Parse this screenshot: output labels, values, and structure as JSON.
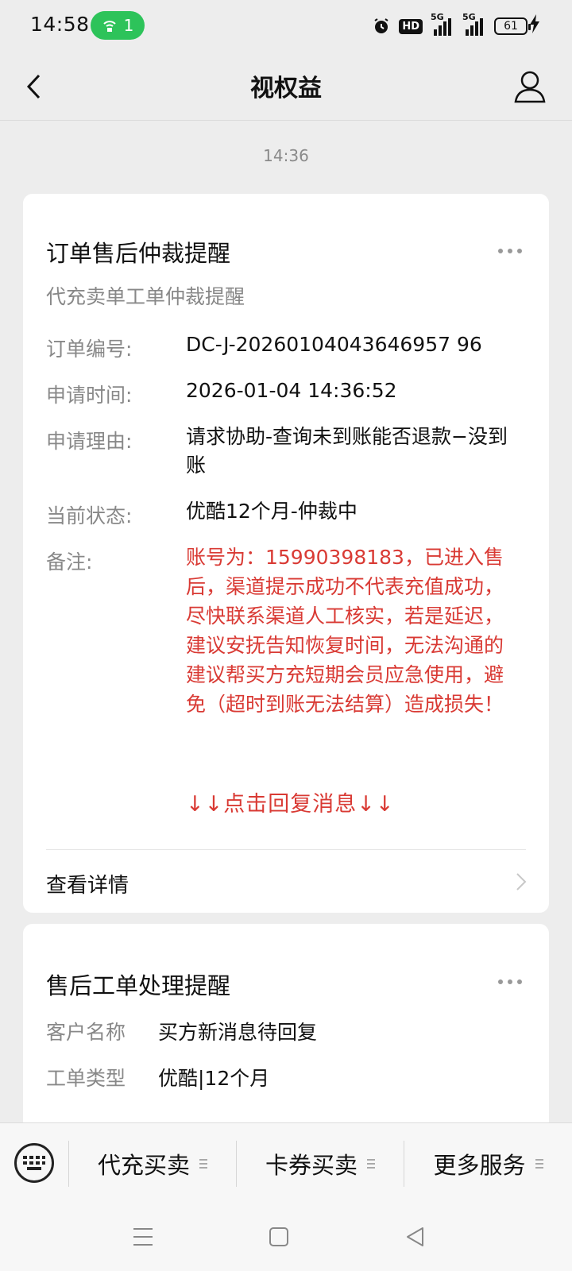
{
  "status_bar": {
    "time": "14:58",
    "hotspot_count": "1",
    "hd_label": "HD",
    "signal1_label": "5G",
    "signal2_label": "5G",
    "battery": "61"
  },
  "nav": {
    "title": "视权益"
  },
  "timestamp": "14:36",
  "card1": {
    "title": "订单售后仲裁提醒",
    "subtitle": "代充卖单工单仲裁提醒",
    "fields": [
      {
        "label": "订单编号:",
        "value": "DC-J-20260104043646957 96"
      },
      {
        "label": "申请时间:",
        "value": "2026-01-04 14:36:52"
      },
      {
        "label": "申请理由:",
        "value": "请求协助-查询未到账能否退款−没到账"
      },
      {
        "label": "当前状态:",
        "value": "优酷12个月-仲裁中"
      },
      {
        "label": "备注:",
        "value": "账号为：15990398183，已进入售后，渠道提示成功不代表充值成功，尽快联系渠道人工核实，若是延迟，建议安抚告知恢复时间，无法沟通的建议帮买方充短期会员应急使用，避免（超时到账无法结算）造成损失！"
      }
    ],
    "reply_hint": "↓↓点击回复消息↓↓",
    "detail_link": "查看详情"
  },
  "card2": {
    "title": "售后工单处理提醒",
    "fields": [
      {
        "label": "客户名称",
        "value": "买方新消息待回复"
      },
      {
        "label": "工单类型",
        "value": "优酷|12个月"
      }
    ]
  },
  "bottom_menu": {
    "items": [
      "代充买卖",
      "卡券买卖",
      "更多服务"
    ]
  },
  "colors": {
    "accent_red": "#d93a34",
    "hotspot_green": "#2dc35a"
  }
}
